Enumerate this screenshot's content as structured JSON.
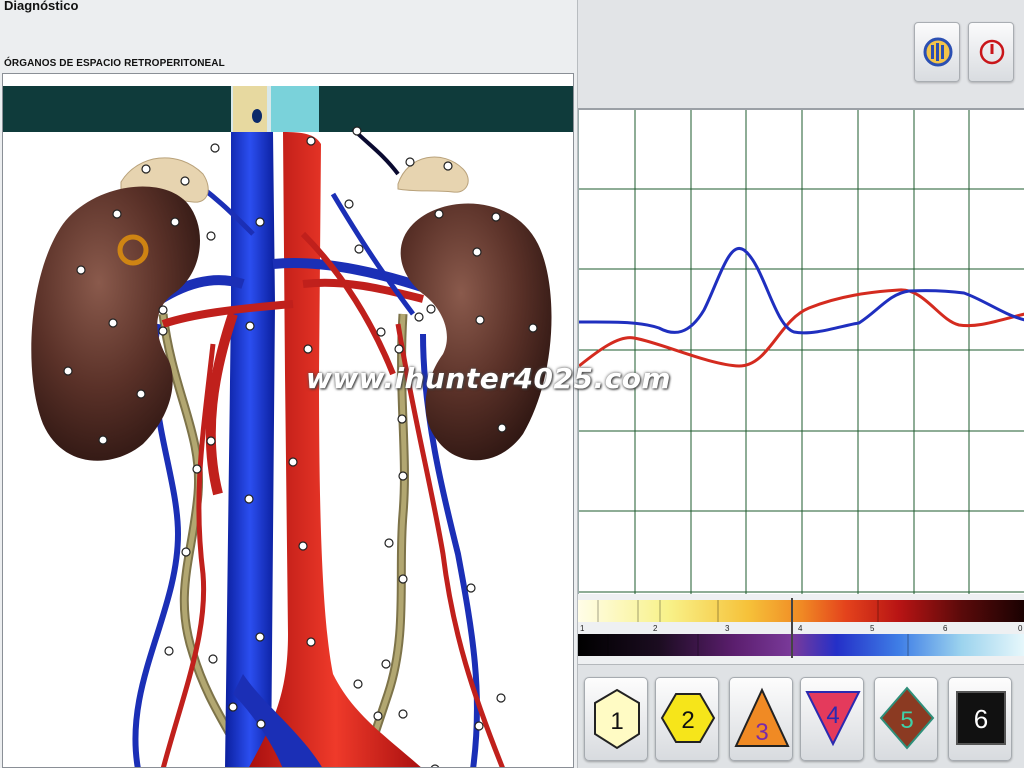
{
  "window": {
    "title": "Diagnóstico"
  },
  "organ_panel": {
    "section_label": "ÓRGANOS DE ESPACIO RETROPERITONEAL"
  },
  "toolbar": {
    "buttons": [
      {
        "icon": "audio-icon"
      },
      {
        "icon": "power-icon"
      }
    ]
  },
  "graph": {
    "series": [
      {
        "color": "#1f2fbf"
      },
      {
        "color": "#d42b1f"
      }
    ]
  },
  "color_scale": {
    "tick_labels": [
      "1",
      "2",
      "3",
      "4",
      "5",
      "6",
      "0"
    ]
  },
  "level_buttons": [
    {
      "label": "1",
      "shape": "hexagon",
      "fill": "#fffbc4"
    },
    {
      "label": "2",
      "shape": "hexagon",
      "fill": "#f6e51a"
    },
    {
      "label": "3",
      "shape": "triangle-up",
      "fill": "#f08a24"
    },
    {
      "label": "4",
      "shape": "triangle-down",
      "fill": "#e43a5c"
    },
    {
      "label": "5",
      "shape": "diamond",
      "fill": "#8b3a22"
    },
    {
      "label": "6",
      "shape": "square",
      "fill": "#111111"
    }
  ],
  "watermark": "www.ihunter4025.com"
}
